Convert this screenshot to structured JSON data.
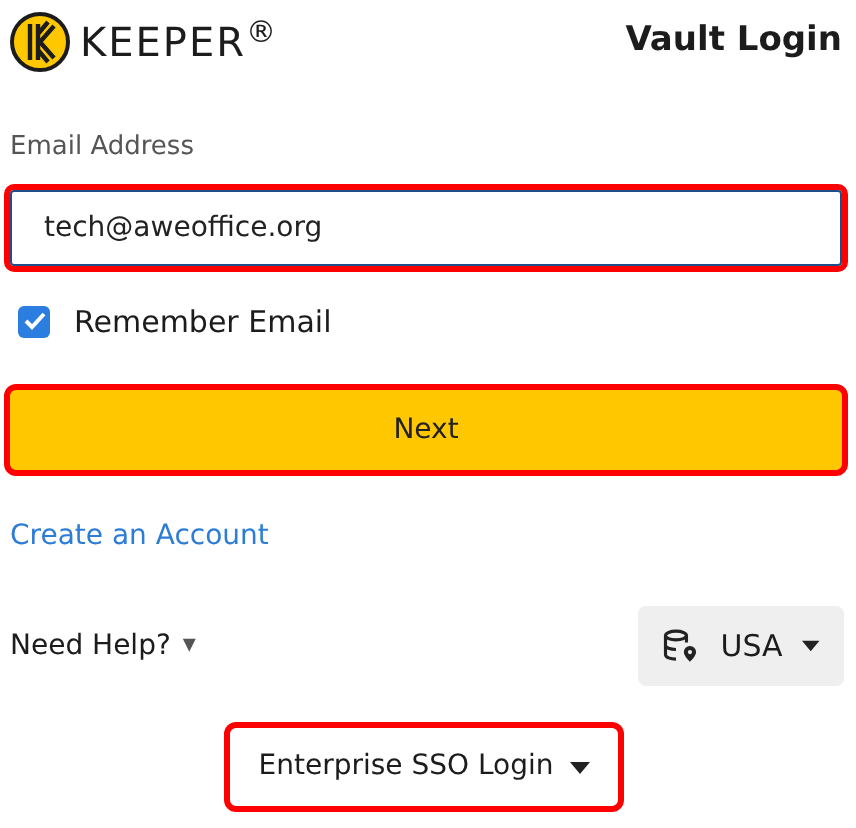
{
  "header": {
    "brand": "KEEPER$^{®}$",
    "title": "Vault Login"
  },
  "email": {
    "label": "Email Address",
    "value": "tech@aweoffice.org",
    "highlighted": true
  },
  "remember": {
    "label": "Remember Email",
    "checked": true
  },
  "next_button": {
    "label": "Next",
    "highlighted": true
  },
  "create_account": "Create an Account",
  "help": {
    "label": "Need Help?",
    "caret": "▾"
  },
  "region": {
    "label": "USA"
  },
  "sso_button": {
    "label": "Enterprise SSO Login",
    "highlighted": true
  }
}
